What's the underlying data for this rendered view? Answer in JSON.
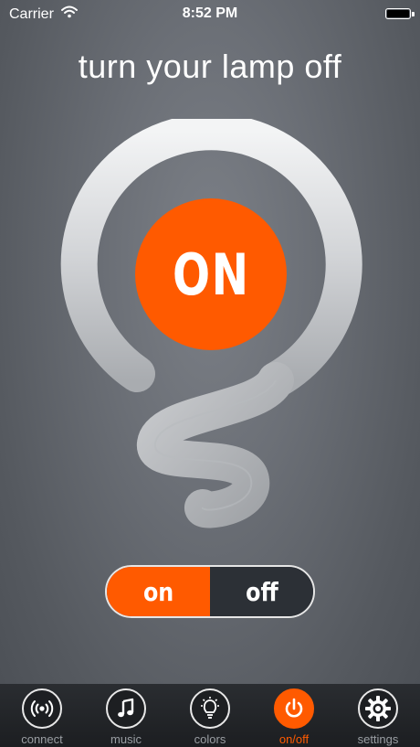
{
  "status_bar": {
    "carrier": "Carrier",
    "time": "8:52 PM"
  },
  "title": "turn your lamp off",
  "lamp": {
    "state_label": "ON",
    "accent_color": "#ff5a00"
  },
  "toggle": {
    "on_label": "on",
    "off_label": "off",
    "selected": "on"
  },
  "tabs": [
    {
      "label": "connect",
      "icon": "wireless-signal-icon",
      "active": false
    },
    {
      "label": "music",
      "icon": "music-note-icon",
      "active": false
    },
    {
      "label": "colors",
      "icon": "light-bulb-icon",
      "active": false
    },
    {
      "label": "on/off",
      "icon": "power-icon",
      "active": true
    },
    {
      "label": "settings",
      "icon": "gear-icon",
      "active": false
    }
  ]
}
